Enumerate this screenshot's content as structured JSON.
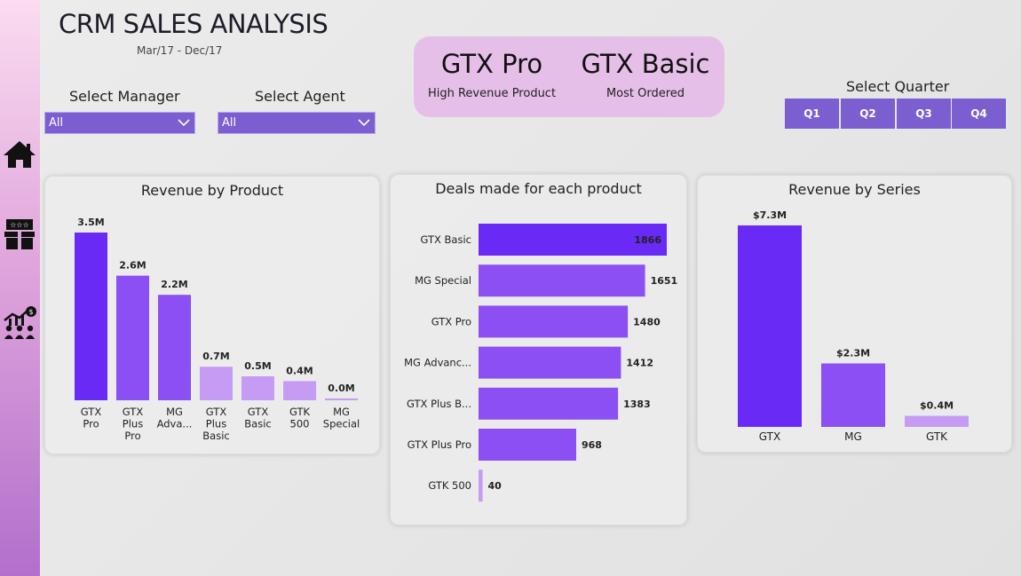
{
  "header": {
    "title": "CRM SALES ANALYSIS",
    "date_range": "Mar/17 - Dec/17"
  },
  "filters": {
    "manager_label": "Select Manager",
    "manager_value": "All",
    "agent_label": "Select Agent",
    "agent_value": "All"
  },
  "kpis": [
    {
      "value": "GTX Pro",
      "label": "High Revenue Product"
    },
    {
      "value": "GTX Basic",
      "label": "Most Ordered"
    }
  ],
  "quarter": {
    "label": "Select Quarter",
    "options": [
      "Q1",
      "Q2",
      "Q3",
      "Q4"
    ]
  },
  "nav": {
    "items": [
      "home-icon",
      "products-icon",
      "sales-team-icon"
    ]
  },
  "colors": {
    "dark_purple": "#6a2af5",
    "mid_purple": "#8b4ff3",
    "light_purple": "#c59bf3",
    "slicer": "#7b5fd0",
    "kpi_bg": "#e6bfe8"
  },
  "chart_data": [
    {
      "type": "bar",
      "title": "Revenue by Product",
      "categories": [
        "GTX Pro",
        "GTX Plus Pro",
        "MG Adva...",
        "GTX Plus Basic",
        "GTX Basic",
        "GTK 500",
        "MG Special"
      ],
      "values": [
        3.5,
        2.6,
        2.2,
        0.7,
        0.5,
        0.4,
        0.0
      ],
      "data_labels": [
        "3.5M",
        "2.6M",
        "2.2M",
        "0.7M",
        "0.5M",
        "0.4M",
        "0.0M"
      ],
      "unit": "M"
    },
    {
      "type": "bar",
      "orientation": "horizontal",
      "title": "Deals made for each product",
      "categories": [
        "GTX Basic",
        "MG Special",
        "GTX Pro",
        "MG Advanc...",
        "GTX Plus B...",
        "GTX Plus Pro",
        "GTK 500"
      ],
      "values": [
        1866,
        1651,
        1480,
        1412,
        1383,
        968,
        40
      ],
      "data_labels": [
        "1866",
        "1651",
        "1480",
        "1412",
        "1383",
        "968",
        "40"
      ]
    },
    {
      "type": "bar",
      "title": "Revenue by Series",
      "categories": [
        "GTX",
        "MG",
        "GTK"
      ],
      "values": [
        7.3,
        2.3,
        0.4
      ],
      "data_labels": [
        "$7.3M",
        "$2.3M",
        "$0.4M"
      ],
      "unit": "$M"
    }
  ]
}
